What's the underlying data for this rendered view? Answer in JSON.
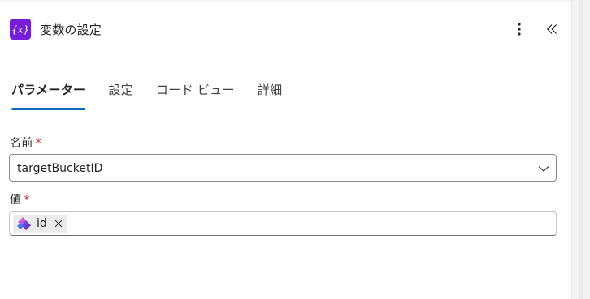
{
  "header": {
    "title": "変数の設定",
    "icon": "variable-icon",
    "accent_color": "#771dd6"
  },
  "tabs": [
    {
      "label": "パラメーター",
      "active": true
    },
    {
      "label": "設定",
      "active": false
    },
    {
      "label": "コード ビュー",
      "active": false
    },
    {
      "label": "詳細",
      "active": false
    }
  ],
  "fields": {
    "name": {
      "label": "名前",
      "required_mark": "*",
      "value": "targetBucketID"
    },
    "value": {
      "label": "値",
      "required_mark": "*",
      "token": {
        "text": "id",
        "icon": "planner-icon"
      }
    }
  },
  "colors": {
    "tab_underline": "#0f6cbd",
    "required": "#bc2f32"
  }
}
